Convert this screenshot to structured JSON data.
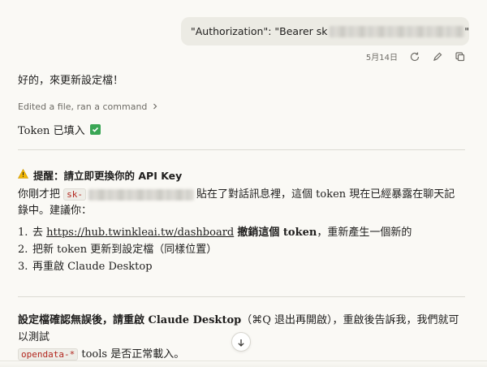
{
  "user_message": {
    "prefix": "\"Authorization\": \"Bearer sk",
    "suffix": "\""
  },
  "message_meta": {
    "date": "5月14日",
    "icons": [
      "retry-icon",
      "edit-icon",
      "copy-icon"
    ]
  },
  "assistant": {
    "intro": "好的，來更新設定檔！",
    "tool_summary": "Edited a file, ran a command",
    "token_status": "Token 已填入",
    "warning": {
      "title": "提醒：請立即更換你的 API Key",
      "para_before": "你剛才把",
      "code": "sk-",
      "para_after": "貼在了對話訊息裡，這個 token 現在已經暴露在聊天記錄中。建議你："
    },
    "steps": [
      {
        "num": "1.",
        "pre": "去 ",
        "link": "https://hub.twinkleai.tw/dashboard",
        "bold": "撤銷這個 token",
        "post": "，重新產生一個新的"
      },
      {
        "num": "2.",
        "text": "把新 token 更新到設定檔（同樣位置）"
      },
      {
        "num": "3.",
        "text": "再重啟 Claude Desktop"
      }
    ],
    "final": {
      "bold1": "設定檔確認無誤後，請重啟 Claude Desktop",
      "mid": "（⌘Q 退出再開啟），重啟後告訴我，我們就可以測試",
      "code": "opendata-*",
      "tail": "tools 是否正常載入。"
    }
  },
  "colors": {
    "background": "#faf9f5",
    "bubble": "#ecebe4",
    "code_text": "#b3261e",
    "check_green": "#3aa655",
    "warning_yellow": "#f2b705"
  }
}
